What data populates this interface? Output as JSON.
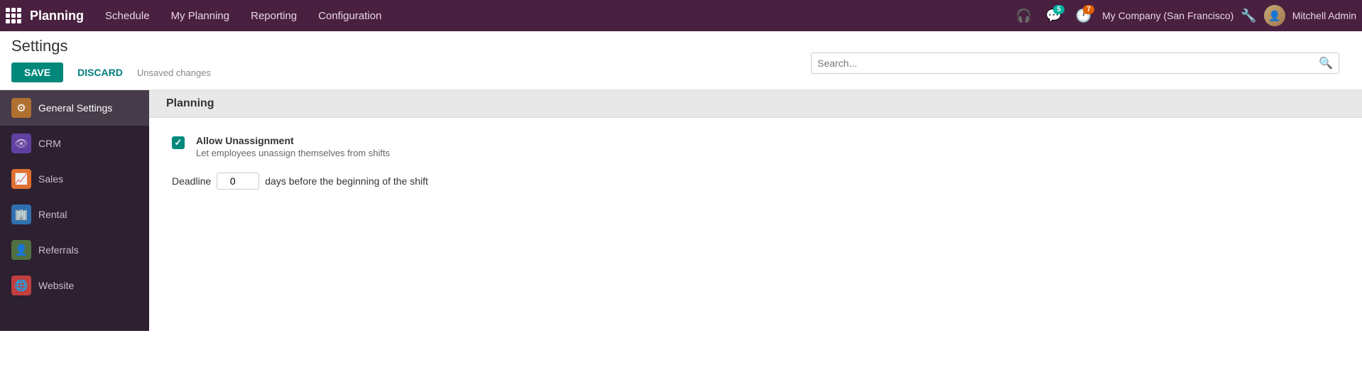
{
  "topnav": {
    "logo": "Planning",
    "nav_items": [
      {
        "label": "Schedule",
        "active": false
      },
      {
        "label": "My Planning",
        "active": false
      },
      {
        "label": "Reporting",
        "active": false
      },
      {
        "label": "Configuration",
        "active": false
      }
    ],
    "support_icon": "headset",
    "chat_badge": "5",
    "activity_badge": "7",
    "company": "My Company (San Francisco)",
    "tools_icon": "⚙",
    "username": "Mitchell Admin"
  },
  "page": {
    "title": "Settings",
    "save_label": "SAVE",
    "discard_label": "DISCARD",
    "unsaved_label": "Unsaved changes"
  },
  "search": {
    "placeholder": "Search..."
  },
  "sidebar": {
    "items": [
      {
        "id": "general-settings",
        "label": "General Settings",
        "icon_class": "icon-gear",
        "icon": "⚙",
        "active": true
      },
      {
        "id": "crm",
        "label": "CRM",
        "icon_class": "icon-crm",
        "icon": "👁",
        "active": false
      },
      {
        "id": "sales",
        "label": "Sales",
        "icon_class": "icon-sales",
        "icon": "📈",
        "active": false
      },
      {
        "id": "rental",
        "label": "Rental",
        "icon_class": "icon-rental",
        "icon": "🏢",
        "active": false
      },
      {
        "id": "referrals",
        "label": "Referrals",
        "icon_class": "icon-referrals",
        "icon": "👤",
        "active": false
      },
      {
        "id": "website",
        "label": "Website",
        "icon_class": "icon-website",
        "icon": "🌐",
        "active": false
      }
    ]
  },
  "content": {
    "section_title": "Planning",
    "settings": [
      {
        "id": "allow-unassignment",
        "checked": true,
        "label": "Allow Unassignment",
        "description": "Let employees unassign themselves from shifts"
      }
    ],
    "deadline": {
      "label": "Deadline",
      "value": "0",
      "suffix": "days before the beginning of the shift"
    }
  }
}
